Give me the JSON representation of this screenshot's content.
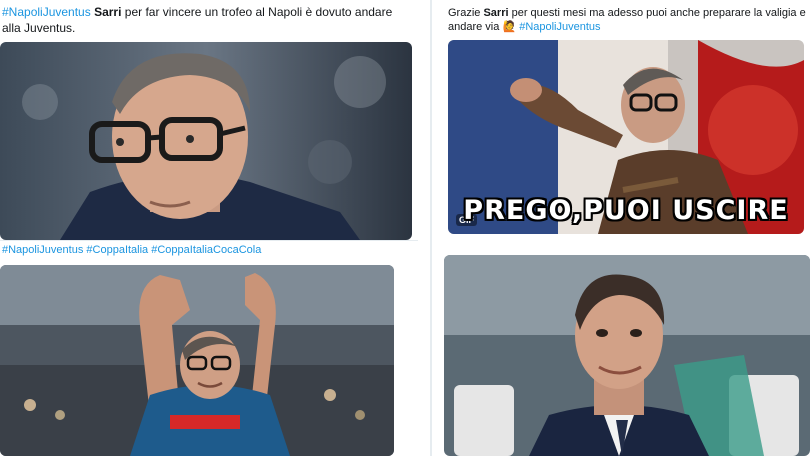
{
  "tweets": [
    {
      "hashtag1": "#NapoliJuventus",
      "bold": "Sarri",
      "text": " per far vincere un trofeo al Napoli è dovuto andare alla Juventus."
    },
    {
      "pre": "Grazie ",
      "bold": "Sarri",
      "text": " per questi mesi ma adesso puoi anche preparare la valigia e andare via ",
      "emoji": "🙋",
      "hashtag1": "#NapoliJuventus",
      "gif_badge": "GIF",
      "overlay": "PREGO,PUOI USCIRE"
    },
    {
      "hashtag1": "#NapoliJuventus",
      "hashtag2": "#CoppaItalia",
      "hashtag3": "#CoppaItaliaCocaCola"
    }
  ],
  "colors": {
    "hashtag": "#1b95e0",
    "text": "#14171a",
    "divider": "#e6ecf0"
  }
}
